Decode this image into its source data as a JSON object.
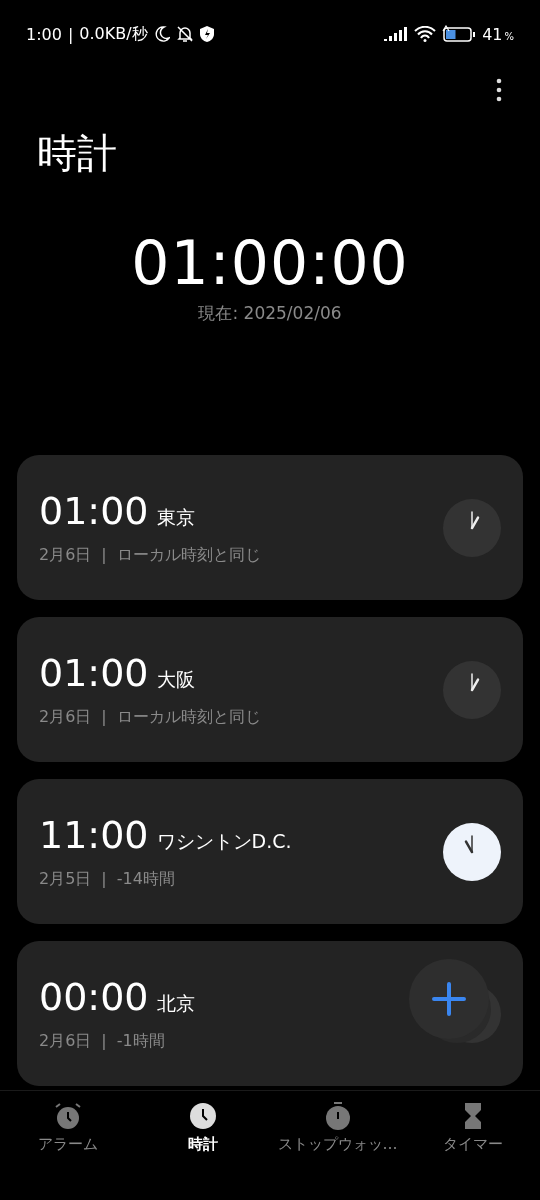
{
  "status_bar": {
    "time": "1:00",
    "separator": "|",
    "speed": "0.0KB/秒",
    "battery_percent": "41",
    "percent_sign": "%"
  },
  "title": "時計",
  "current": {
    "time": "01:00:00",
    "date": "現在: 2025/02/06"
  },
  "cities": [
    {
      "time": "01:00",
      "city": "東京",
      "date": "2月6日",
      "separator": "|",
      "offset": "ローカル時刻と同じ",
      "kind": "night"
    },
    {
      "time": "01:00",
      "city": "大阪",
      "date": "2月6日",
      "separator": "|",
      "offset": "ローカル時刻と同じ",
      "kind": "night"
    },
    {
      "time": "11:00",
      "city": "ワシントンD.C.",
      "date": "2月5日",
      "separator": "|",
      "offset": "-14時間",
      "kind": "day"
    },
    {
      "time": "00:00",
      "city": "北京",
      "date": "2月6日",
      "separator": "|",
      "offset": "-1時間",
      "kind": "night"
    }
  ],
  "nav": [
    {
      "kind": "alarm",
      "label": "アラーム",
      "selected": false
    },
    {
      "kind": "clock",
      "label": "時計",
      "selected": true
    },
    {
      "kind": "stopwatch",
      "label": "ストップウォッ…",
      "selected": false
    },
    {
      "kind": "timer",
      "label": "タイマー",
      "selected": false
    }
  ]
}
